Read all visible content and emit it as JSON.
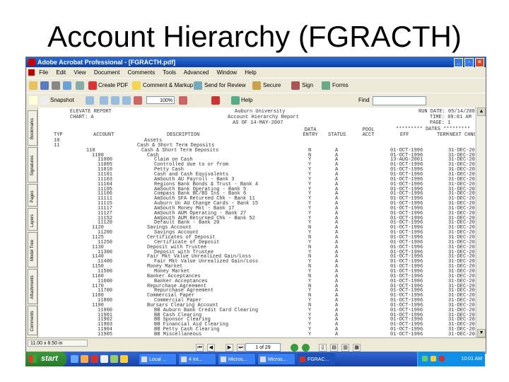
{
  "slide": {
    "title": "Account Hierarchy (FGRACTH)"
  },
  "window": {
    "title": "Adobe Acrobat Professional - [FGRACTH.pdf]"
  },
  "menu": [
    "File",
    "Edit",
    "View",
    "Document",
    "Comments",
    "Tools",
    "Advanced",
    "Window",
    "Help"
  ],
  "toolbar1": {
    "create_pdf": "Create PDF",
    "comment_markup": "Comment & Markup",
    "send_for_review": "Send for Review",
    "secure": "Secure",
    "sign": "Sign",
    "forms": "Forms"
  },
  "toolbar2": {
    "snapshot": "Snapshot",
    "zoom": "100%",
    "help": "Help",
    "find_label": "Find"
  },
  "nav_tabs": [
    "Bookmarks",
    "Signatures",
    "Pages",
    "Layers",
    "Model Tree",
    "Attachments",
    "Comments"
  ],
  "report": {
    "left_header": [
      "ELEVATE REPORT",
      "CHART: A"
    ],
    "center_header": [
      "Auburn University",
      "Account Hierarchy Report",
      "AS OF 14-MAY-2007"
    ],
    "right_header": [
      "RUN DATE: 05/14/2007",
      "TIME: 09:01 AM",
      "PAGE: 1"
    ],
    "eff_dates": "********* DATES *********",
    "columns": [
      "TYP",
      "ACCOUNT",
      "DESCRIPTION",
      "DATA ENTRY",
      "STATUS",
      "POOL ACCT",
      "EFF",
      "TERM",
      "NEXT CHNG"
    ],
    "rows": [
      [
        "10",
        "",
        "Assets",
        "",
        "",
        "",
        "",
        "",
        ""
      ],
      [
        "11",
        "",
        "Cash & Short Term Deposits",
        "",
        "",
        "",
        "",
        "",
        ""
      ],
      [
        "",
        "110",
        "Cash & Short Term Deposits",
        "N",
        "A",
        "",
        "01-OCT-1996",
        "",
        "31-DEC-2099"
      ],
      [
        "",
        "1100",
        "Cash",
        "N",
        "A",
        "",
        "01-OCT-1996",
        "",
        "31-DEC-2099"
      ],
      [
        "",
        "11000",
        "Claim on Cash",
        "Y",
        "A",
        "",
        "13-AUG-2001",
        "",
        "31-DEC-2099"
      ],
      [
        "",
        "11005",
        "Controlled due to or from",
        "Y",
        "A",
        "",
        "01-OCT-1996",
        "",
        "31-DEC-2099"
      ],
      [
        "",
        "11010",
        "Petty Cash",
        "Y",
        "A",
        "",
        "01-OCT-1996",
        "",
        "31-DEC-2099"
      ],
      [
        "",
        "11101",
        "Cash and Cash Equivalents",
        "Y",
        "A",
        "",
        "01-OCT-1996",
        "",
        "31-DEC-2099"
      ],
      [
        "",
        "11103",
        "AmSouth AU Payroll - Bank 3",
        "Y",
        "A",
        "",
        "01-OCT-1996",
        "",
        "31-DEC-2099"
      ],
      [
        "",
        "11104",
        "Regions Bank Bonds & Trust - Bank 4",
        "Y",
        "A",
        "",
        "01-OCT-1996",
        "",
        "31-DEC-2099"
      ],
      [
        "",
        "11105",
        "AmSouth Bank Operating - Bank 5",
        "Y",
        "A",
        "",
        "01-OCT-1996",
        "",
        "31-DEC-2099"
      ],
      [
        "",
        "11106",
        "Compass Bank BC/BS Ins - Bank 6",
        "Y",
        "A",
        "",
        "01-OCT-1996",
        "",
        "31-DEC-2099"
      ],
      [
        "",
        "11111",
        "AmSouth SFA Returned Chk - Bank 11",
        "Y",
        "A",
        "",
        "01-OCT-1996",
        "",
        "31-DEC-2099"
      ],
      [
        "",
        "11115",
        "Auburn Un AU Change Cards - Bank 15",
        "Y",
        "A",
        "",
        "01-OCT-1996",
        "",
        "31-DEC-2099"
      ],
      [
        "",
        "11117",
        "AmSouth Money Mkt - Bank 17",
        "Y",
        "A",
        "",
        "01-OCT-1996",
        "",
        "31-DEC-2099"
      ],
      [
        "",
        "11127",
        "AmSouth AUM Operating - Bank 27",
        "Y",
        "A",
        "",
        "01-OCT-1996",
        "",
        "31-DEC-2099"
      ],
      [
        "",
        "11152",
        "AmSouth AUM Returned Chk - Bank 52",
        "Y",
        "A",
        "",
        "01-OCT-1996",
        "",
        "31-DEC-2099"
      ],
      [
        "",
        "11120",
        "Default Bank - Bank 20",
        "Y",
        "A",
        "",
        "01-OCT-1996",
        "",
        "31-DEC-2099"
      ],
      [
        "",
        "1120",
        "Savings Account",
        "N",
        "A",
        "",
        "01-OCT-1996",
        "",
        "31-DEC-2099"
      ],
      [
        "",
        "11200",
        "Savings Account",
        "Y",
        "A",
        "",
        "01-OCT-1996",
        "",
        "31-DEC-2099"
      ],
      [
        "",
        "1125",
        "Certificates of Deposit",
        "N",
        "A",
        "",
        "01-OCT-1996",
        "",
        "31-DEC-2099"
      ],
      [
        "",
        "11250",
        "Certificate of Deposit",
        "Y",
        "A",
        "",
        "01-OCT-1996",
        "",
        "31-DEC-2099"
      ],
      [
        "",
        "1130",
        "Deposit with Trustee",
        "N",
        "A",
        "",
        "01-OCT-1996",
        "",
        "31-DEC-2099"
      ],
      [
        "",
        "11300",
        "Deposit with Trustee",
        "Y",
        "A",
        "",
        "01-OCT-1996",
        "",
        "31-DEC-2099"
      ],
      [
        "",
        "1140",
        "Fair Mkt Value Unrealized Gain/Loss",
        "N",
        "A",
        "",
        "01-OCT-1996",
        "",
        "31-DEC-2099"
      ],
      [
        "",
        "11400",
        "Fair Mkt Value Unrealized Gain/Loss",
        "Y",
        "A",
        "",
        "01-OCT-1996",
        "",
        "31-DEC-2099"
      ],
      [
        "",
        "1150",
        "Money Market",
        "N",
        "A",
        "",
        "01-OCT-1996",
        "",
        "31-DEC-2099"
      ],
      [
        "",
        "11500",
        "Money Market",
        "Y",
        "A",
        "",
        "01-OCT-1996",
        "",
        "31-DEC-2099"
      ],
      [
        "",
        "1160",
        "Banker Acceptances",
        "N",
        "A",
        "",
        "01-OCT-1996",
        "",
        "31-DEC-2099"
      ],
      [
        "",
        "11600",
        "Banker Acceptances",
        "Y",
        "A",
        "",
        "01-OCT-1996",
        "",
        "31-DEC-2099"
      ],
      [
        "",
        "1170",
        "Repurchase Agreement",
        "N",
        "A",
        "",
        "01-OCT-1996",
        "",
        "31-DEC-2099"
      ],
      [
        "",
        "11700",
        "Repurchase Agreement",
        "Y",
        "A",
        "",
        "01-OCT-1996",
        "",
        "31-DEC-2099"
      ],
      [
        "",
        "1180",
        "Commercial Paper",
        "N",
        "A",
        "",
        "01-OCT-1996",
        "",
        "31-DEC-2099"
      ],
      [
        "",
        "11800",
        "Commercial Paper",
        "Y",
        "A",
        "",
        "01-OCT-1996",
        "",
        "31-DEC-2099"
      ],
      [
        "",
        "1190",
        "Bursars Clearing Account",
        "N",
        "A",
        "",
        "01-OCT-1996",
        "",
        "31-DEC-2099"
      ],
      [
        "",
        "11900",
        "BB Auburn Bank Credit Card Clearing",
        "Y",
        "A",
        "",
        "01-OCT-1996",
        "",
        "31-DEC-2099"
      ],
      [
        "",
        "11901",
        "BB Cash Clearing",
        "Y",
        "A",
        "",
        "01-OCT-1996",
        "",
        "31-DEC-2099"
      ],
      [
        "",
        "11902",
        "BB Sponsor Clearing",
        "Y",
        "A",
        "",
        "01-OCT-1996",
        "",
        "31-DEC-2099"
      ],
      [
        "",
        "11903",
        "BB Financial Aid Clearing",
        "Y",
        "A",
        "",
        "01-OCT-1996",
        "",
        "31-DEC-2099"
      ],
      [
        "",
        "11904",
        "BB Petty Cash Clearing",
        "Y",
        "A",
        "",
        "01-OCT-1996",
        "",
        "31-DEC-2099"
      ],
      [
        "",
        "11905",
        "BB Miscellaneous",
        "Y",
        "A",
        "",
        "01-OCT-1996",
        "",
        "31-DEC-2099"
      ]
    ]
  },
  "statusbar": {
    "page_size": "11.00 x 8.50 in",
    "page_box": "1 of 29"
  },
  "taskbar": {
    "start": "start",
    "tasks": [
      "Local ...",
      "4 Int...",
      "Micros...",
      "Micros...",
      "FGRAC..."
    ],
    "clock": "10:01 AM"
  }
}
